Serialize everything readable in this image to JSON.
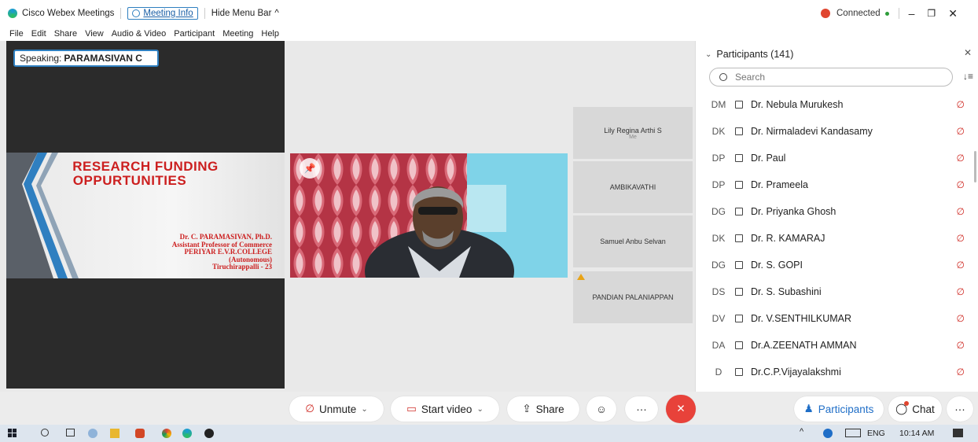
{
  "titlebar": {
    "app_name": "Cisco Webex Meetings",
    "meeting_info": "Meeting Info",
    "hide_menu_bar": "Hide Menu Bar",
    "status": "Connected",
    "status_color": "#2e9d3a",
    "record_color": "#e0452f"
  },
  "menu": [
    "File",
    "Edit",
    "Share",
    "View",
    "Audio & Video",
    "Participant",
    "Meeting",
    "Help"
  ],
  "speaking": {
    "label": "Speaking:",
    "name": "PARAMASIVAN C"
  },
  "slide": {
    "title_line1": "RESEARCH  FUNDING",
    "title_line2": "OPPURTUNITIES",
    "lines": [
      "Dr. C. PARAMASIVAN, Ph.D.",
      "Assistant Professor of Commerce",
      "PERIYAR E.V.R.COLLEGE",
      "(Autonomous)",
      "Tiruchirappalli - 23"
    ]
  },
  "tiles": [
    {
      "name": "Lily Regina Arthi S",
      "sub": "Me"
    },
    {
      "name": "AMBIKAVATHI",
      "sub": ""
    },
    {
      "name": "Samuel Anbu Selvan",
      "sub": ""
    },
    {
      "name": "PANDIAN PALANIAPPAN",
      "sub": ""
    }
  ],
  "panel": {
    "title": "Participants (141)",
    "search_placeholder": "Search",
    "participants": [
      {
        "initials": "DM",
        "name": "Dr. Nebula Murukesh"
      },
      {
        "initials": "DK",
        "name": "Dr. Nirmaladevi Kandasamy"
      },
      {
        "initials": "DP",
        "name": "Dr. Paul"
      },
      {
        "initials": "DP",
        "name": "Dr. Prameela"
      },
      {
        "initials": "DG",
        "name": "Dr. Priyanka Ghosh"
      },
      {
        "initials": "DK",
        "name": "Dr. R. KAMARAJ"
      },
      {
        "initials": "DG",
        "name": "Dr. S. GOPI"
      },
      {
        "initials": "DS",
        "name": "Dr. S. Subashini"
      },
      {
        "initials": "DV",
        "name": "Dr. V.SENTHILKUMAR"
      },
      {
        "initials": "DA",
        "name": "Dr.A.ZEENATH AMMAN"
      },
      {
        "initials": "D",
        "name": "Dr.C.P.Vijayalakshmi"
      }
    ]
  },
  "controls": {
    "unmute": "Unmute",
    "start_video": "Start video",
    "share": "Share",
    "participants": "Participants",
    "chat": "Chat",
    "end_color": "#e8423a"
  },
  "taskbar": {
    "language": "ENG",
    "time": "10:14 AM"
  },
  "icons": [
    "webex-logo-icon",
    "shield-icon",
    "mic-off-icon",
    "video-off-icon",
    "share-icon",
    "emoji-icon",
    "more-icon",
    "close-call-icon",
    "participants-icon",
    "chat-icon",
    "search-icon",
    "sort-icon",
    "windows-start-icon",
    "bluetooth-icon",
    "notification-icon"
  ]
}
